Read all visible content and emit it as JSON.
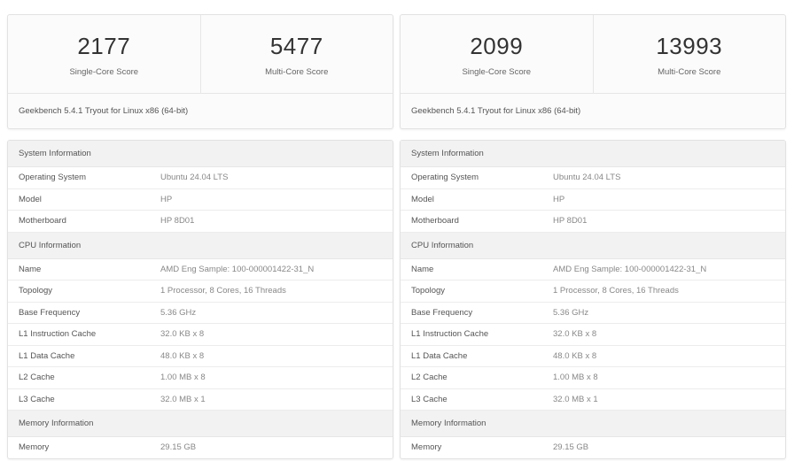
{
  "results": [
    {
      "single_core_score": "2177",
      "single_core_label": "Single-Core Score",
      "multi_core_score": "5477",
      "multi_core_label": "Multi-Core Score",
      "version": "Geekbench 5.4.1 Tryout for Linux x86 (64-bit)",
      "system_info": {
        "header": "System Information",
        "operating_system": {
          "label": "Operating System",
          "value": "Ubuntu 24.04 LTS"
        },
        "model": {
          "label": "Model",
          "value": "HP"
        },
        "motherboard": {
          "label": "Motherboard",
          "value": "HP 8D01"
        }
      },
      "cpu_info": {
        "header": "CPU Information",
        "name": {
          "label": "Name",
          "value": "AMD Eng Sample: 100-000001422-31_N"
        },
        "topology": {
          "label": "Topology",
          "value": "1 Processor, 8 Cores, 16 Threads"
        },
        "base_frequency": {
          "label": "Base Frequency",
          "value": "5.36 GHz"
        },
        "l1_instruction_cache": {
          "label": "L1 Instruction Cache",
          "value": "32.0 KB x 8"
        },
        "l1_data_cache": {
          "label": "L1 Data Cache",
          "value": "48.0 KB x 8"
        },
        "l2_cache": {
          "label": "L2 Cache",
          "value": "1.00 MB x 8"
        },
        "l3_cache": {
          "label": "L3 Cache",
          "value": "32.0 MB x 1"
        }
      },
      "memory_info": {
        "header": "Memory Information",
        "memory": {
          "label": "Memory",
          "value": "29.15 GB"
        }
      }
    },
    {
      "single_core_score": "2099",
      "single_core_label": "Single-Core Score",
      "multi_core_score": "13993",
      "multi_core_label": "Multi-Core Score",
      "version": "Geekbench 5.4.1 Tryout for Linux x86 (64-bit)",
      "system_info": {
        "header": "System Information",
        "operating_system": {
          "label": "Operating System",
          "value": "Ubuntu 24.04 LTS"
        },
        "model": {
          "label": "Model",
          "value": "HP"
        },
        "motherboard": {
          "label": "Motherboard",
          "value": "HP 8D01"
        }
      },
      "cpu_info": {
        "header": "CPU Information",
        "name": {
          "label": "Name",
          "value": "AMD Eng Sample: 100-000001422-31_N"
        },
        "topology": {
          "label": "Topology",
          "value": "1 Processor, 8 Cores, 16 Threads"
        },
        "base_frequency": {
          "label": "Base Frequency",
          "value": "5.36 GHz"
        },
        "l1_instruction_cache": {
          "label": "L1 Instruction Cache",
          "value": "32.0 KB x 8"
        },
        "l1_data_cache": {
          "label": "L1 Data Cache",
          "value": "48.0 KB x 8"
        },
        "l2_cache": {
          "label": "L2 Cache",
          "value": "1.00 MB x 8"
        },
        "l3_cache": {
          "label": "L3 Cache",
          "value": "32.0 MB x 1"
        }
      },
      "memory_info": {
        "header": "Memory Information",
        "memory": {
          "label": "Memory",
          "value": "29.15 GB"
        }
      }
    }
  ]
}
